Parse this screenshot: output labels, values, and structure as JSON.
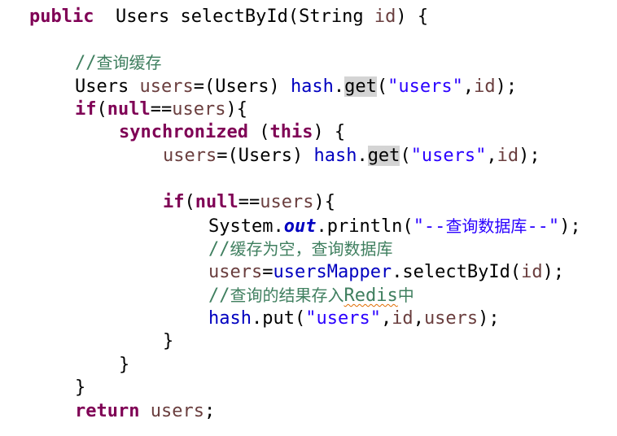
{
  "editor": {
    "lines": [
      [
        {
          "t": "public",
          "c": "kw"
        },
        {
          "t": "  Users selectById(String ",
          "c": ""
        },
        {
          "t": "id",
          "c": "var"
        },
        {
          "t": ") {",
          "c": ""
        }
      ],
      [],
      [
        {
          "t": "//",
          "c": "cmt-mono"
        },
        {
          "t": "查询缓存",
          "c": "cmt"
        }
      ],
      [
        {
          "t": "Users ",
          "c": ""
        },
        {
          "t": "users",
          "c": "var"
        },
        {
          "t": "=(Users) ",
          "c": ""
        },
        {
          "t": "hash",
          "c": "fld"
        },
        {
          "t": ".",
          "c": ""
        },
        {
          "t": "get",
          "c": "hl"
        },
        {
          "t": "(",
          "c": ""
        },
        {
          "t": "\"users\"",
          "c": "str"
        },
        {
          "t": ",",
          "c": ""
        },
        {
          "t": "id",
          "c": "var"
        },
        {
          "t": ");",
          "c": ""
        }
      ],
      [
        {
          "t": "if",
          "c": "kw"
        },
        {
          "t": "(",
          "c": ""
        },
        {
          "t": "null",
          "c": "kw"
        },
        {
          "t": "==",
          "c": ""
        },
        {
          "t": "users",
          "c": "var"
        },
        {
          "t": "){",
          "c": ""
        }
      ],
      [
        {
          "t": "synchronized",
          "c": "kw"
        },
        {
          "t": " (",
          "c": ""
        },
        {
          "t": "this",
          "c": "kw"
        },
        {
          "t": ") {",
          "c": ""
        }
      ],
      [
        {
          "t": "users",
          "c": "var"
        },
        {
          "t": "=(Users) ",
          "c": ""
        },
        {
          "t": "hash",
          "c": "fld"
        },
        {
          "t": ".",
          "c": ""
        },
        {
          "t": "get",
          "c": "hl"
        },
        {
          "t": "(",
          "c": ""
        },
        {
          "t": "\"users\"",
          "c": "str"
        },
        {
          "t": ",",
          "c": ""
        },
        {
          "t": "id",
          "c": "var"
        },
        {
          "t": ");",
          "c": ""
        }
      ],
      [],
      [
        {
          "t": "if",
          "c": "kw"
        },
        {
          "t": "(",
          "c": ""
        },
        {
          "t": "null",
          "c": "kw"
        },
        {
          "t": "==",
          "c": ""
        },
        {
          "t": "users",
          "c": "var"
        },
        {
          "t": "){",
          "c": ""
        }
      ],
      [
        {
          "t": "System.",
          "c": ""
        },
        {
          "t": "out",
          "c": "static"
        },
        {
          "t": ".println(",
          "c": ""
        },
        {
          "t": "\"--",
          "c": "str"
        },
        {
          "t": "查询数据库",
          "c": "str cn"
        },
        {
          "t": "--\"",
          "c": "str"
        },
        {
          "t": ");",
          "c": ""
        }
      ],
      [
        {
          "t": "//",
          "c": "cmt-mono"
        },
        {
          "t": "缓存为空，查询数据库",
          "c": "cmt"
        }
      ],
      [
        {
          "t": "users",
          "c": "var"
        },
        {
          "t": "=",
          "c": ""
        },
        {
          "t": "usersMapper",
          "c": "fld"
        },
        {
          "t": ".selectById(",
          "c": ""
        },
        {
          "t": "id",
          "c": "var"
        },
        {
          "t": ");",
          "c": ""
        }
      ],
      [
        {
          "t": "//",
          "c": "cmt-mono"
        },
        {
          "t": "查询的结果存入",
          "c": "cmt"
        },
        {
          "t": "Redis",
          "c": "cmt-mono sq"
        },
        {
          "t": "中",
          "c": "cmt"
        }
      ],
      [
        {
          "t": "hash",
          "c": "fld"
        },
        {
          "t": ".put(",
          "c": ""
        },
        {
          "t": "\"users\"",
          "c": "str"
        },
        {
          "t": ",",
          "c": ""
        },
        {
          "t": "id",
          "c": "var"
        },
        {
          "t": ",",
          "c": ""
        },
        {
          "t": "users",
          "c": "var"
        },
        {
          "t": ");",
          "c": ""
        }
      ],
      [
        {
          "t": "}",
          "c": ""
        }
      ],
      [
        {
          "t": "}",
          "c": ""
        }
      ],
      [
        {
          "t": "}",
          "c": ""
        }
      ],
      [
        {
          "t": "return",
          "c": "kw"
        },
        {
          "t": " ",
          "c": ""
        },
        {
          "t": "users",
          "c": "var"
        },
        {
          "t": ";",
          "c": ""
        }
      ]
    ]
  }
}
